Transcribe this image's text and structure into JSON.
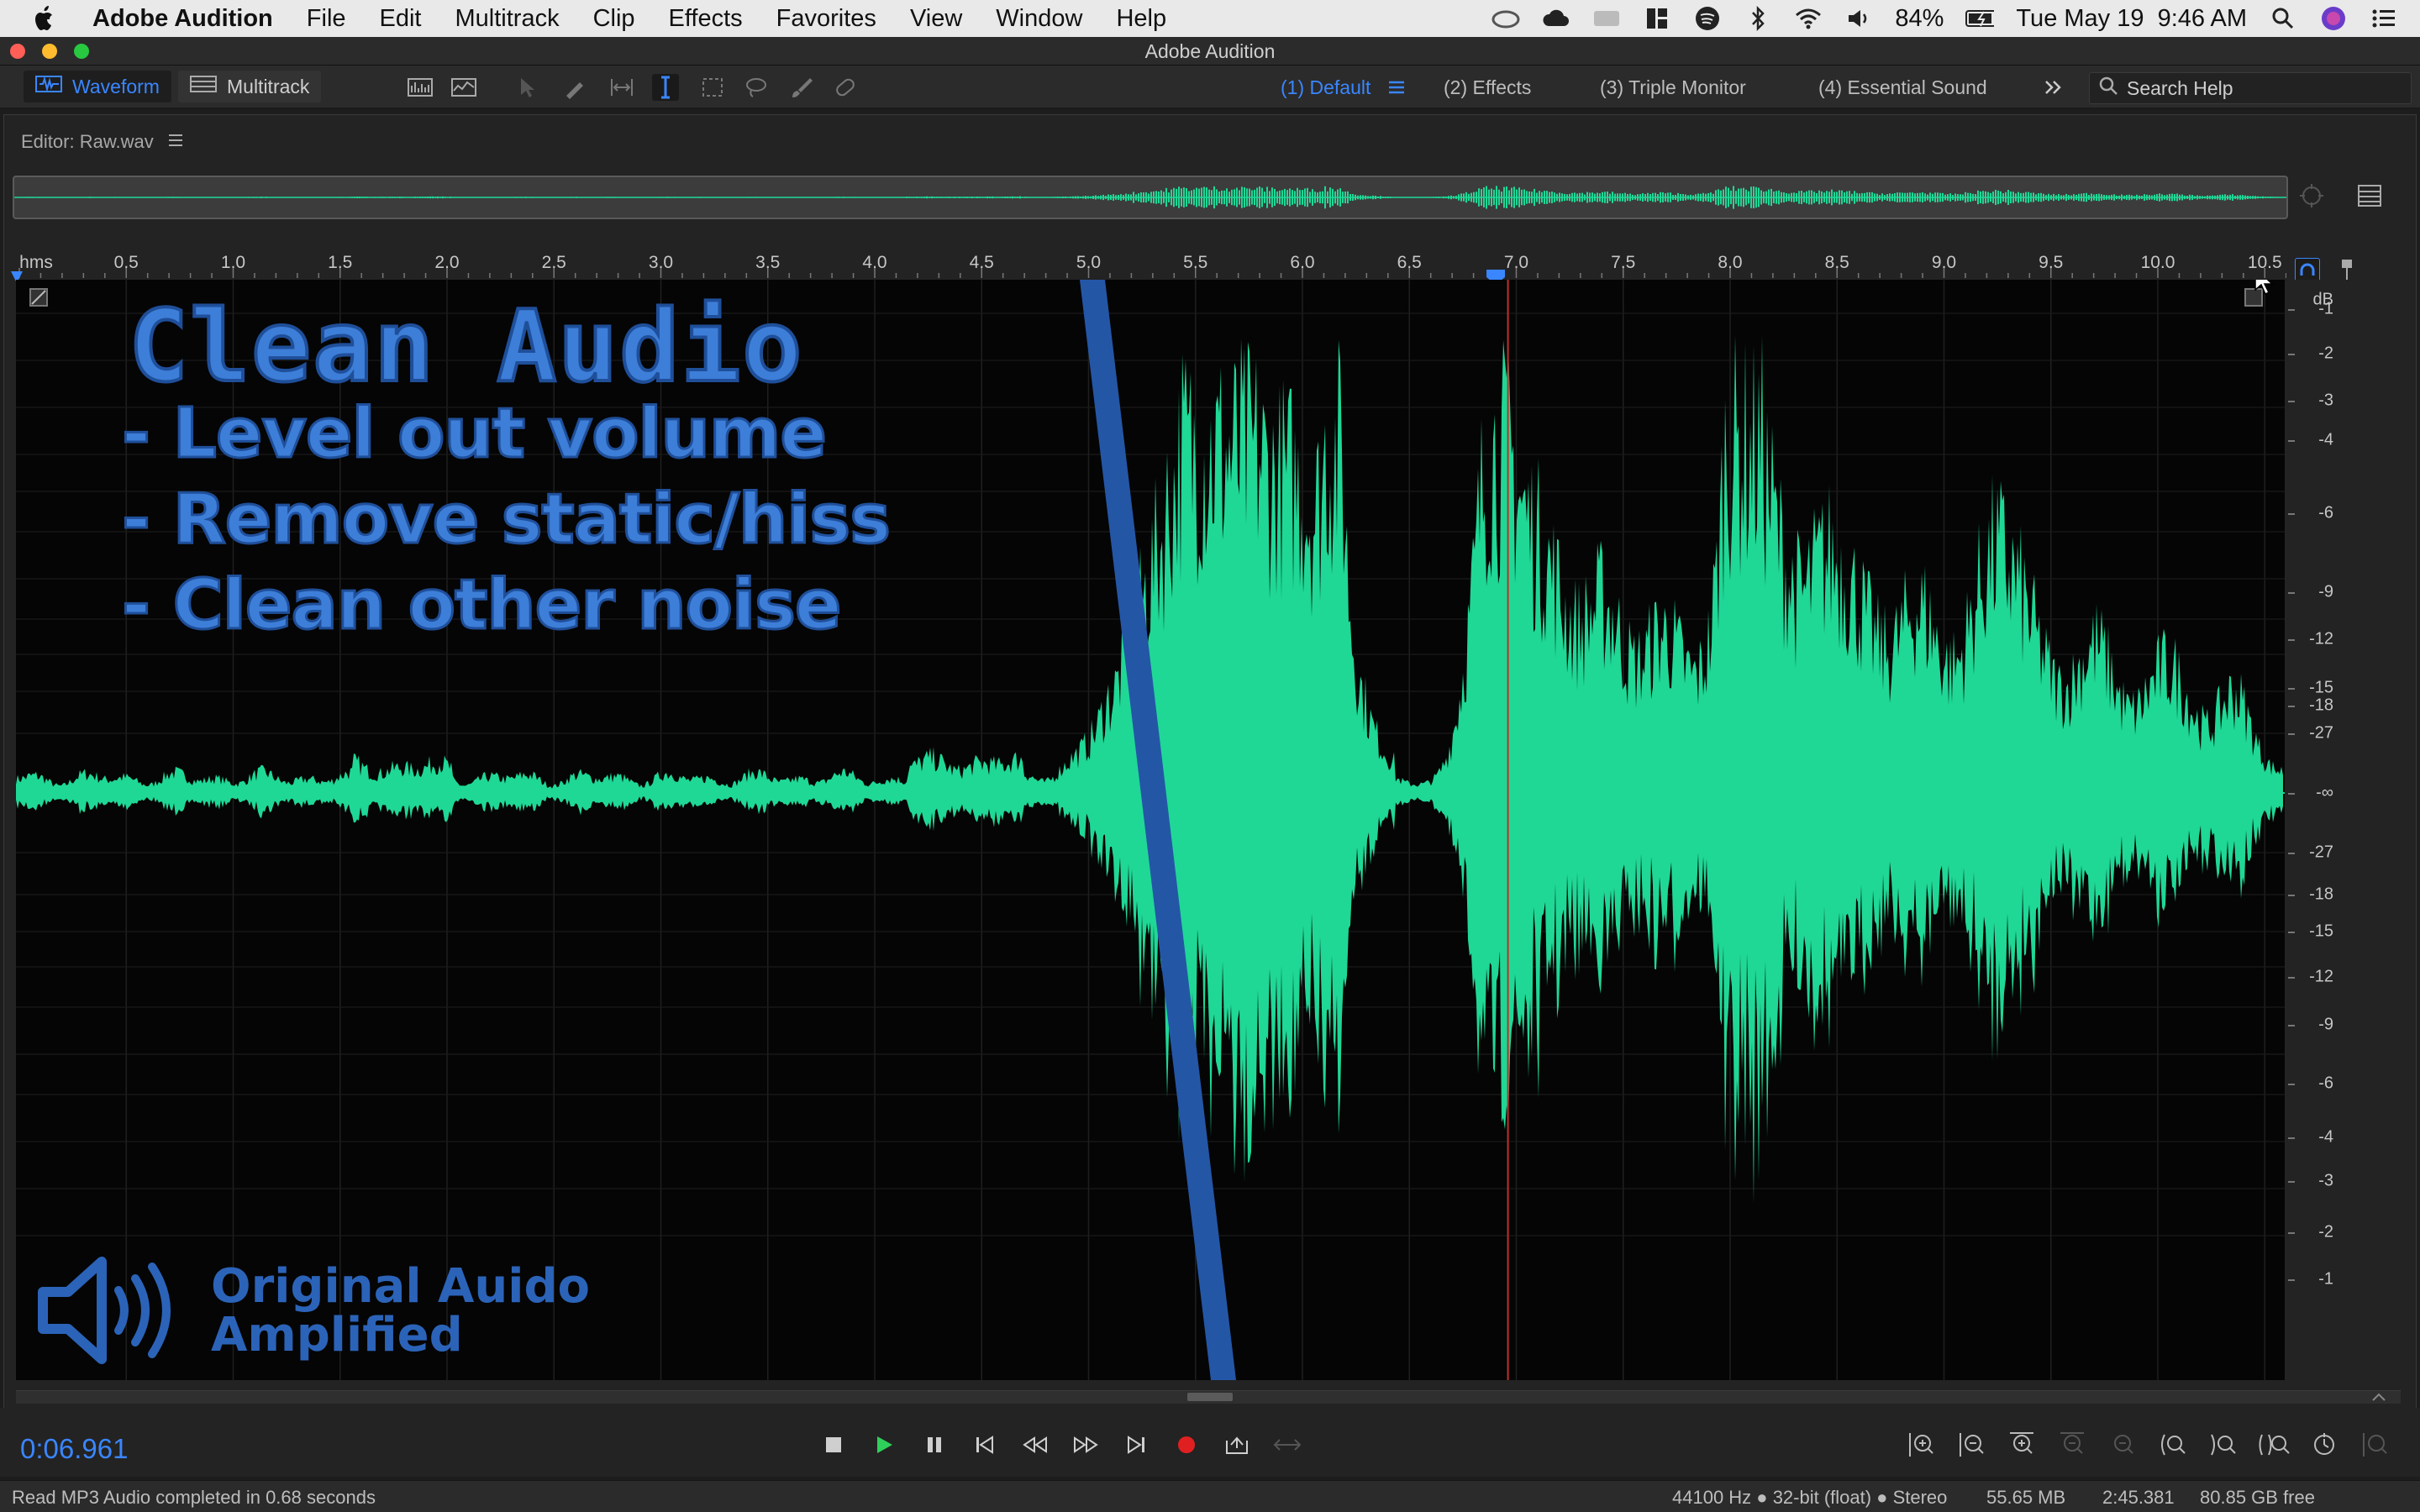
{
  "menubar": {
    "app_name": "Adobe Audition",
    "items": [
      "File",
      "Edit",
      "Multitrack",
      "Clip",
      "Effects",
      "Favorites",
      "View",
      "Window",
      "Help"
    ],
    "battery": "84%",
    "datetime": "Tue May 19  9:46 AM"
  },
  "window": {
    "title": "Adobe Audition"
  },
  "toolbar": {
    "waveform_label": "Waveform",
    "multitrack_label": "Multitrack",
    "workspaces": [
      "(1) Default",
      "(2) Effects",
      "(3) Triple Monitor",
      "(4) Essential Sound"
    ],
    "active_workspace": "(1) Default",
    "search_placeholder": "Search Help"
  },
  "editor": {
    "title": "Editor: Raw.wav",
    "ruler_unit": "hms",
    "ruler_ticks": [
      "0.5",
      "1.0",
      "1.5",
      "2.0",
      "2.5",
      "3.0",
      "3.5",
      "4.0",
      "4.5",
      "5.0",
      "5.5",
      "6.0",
      "6.5",
      "7.0",
      "7.5",
      "8.0",
      "8.5",
      "9.0",
      "9.5",
      "10.0",
      "10.5"
    ],
    "db_unit": "dB",
    "db_labels": [
      "-1",
      "-2",
      "-3",
      "-4",
      "-6",
      "-9",
      "-12",
      "-15",
      "-18",
      "-27",
      "-∞",
      "-27",
      "-18",
      "-15",
      "-12",
      "-9",
      "-6",
      "-4",
      "-3",
      "-2",
      "-1"
    ],
    "playhead_time": 6.961
  },
  "overlay": {
    "title": "Clean Audio",
    "bullets": [
      "- Level out volume",
      "- Remove static/hiss",
      "- Clean other noise"
    ],
    "caption_line1": "Original Auido",
    "caption_line2": "Amplified"
  },
  "transport": {
    "timecode": "0:06.961"
  },
  "status": {
    "message": "Read MP3 Audio completed in 0.68 seconds",
    "format": "44100 Hz ● 32-bit (float) ● Stereo",
    "size": "55.65 MB",
    "duration": "2:45.381",
    "free": "80.85 GB free"
  },
  "colors": {
    "accent": "#3a86ff",
    "wave": "#1fd896",
    "overlay": "#3d7ed8",
    "playhead": "#c0302a"
  }
}
